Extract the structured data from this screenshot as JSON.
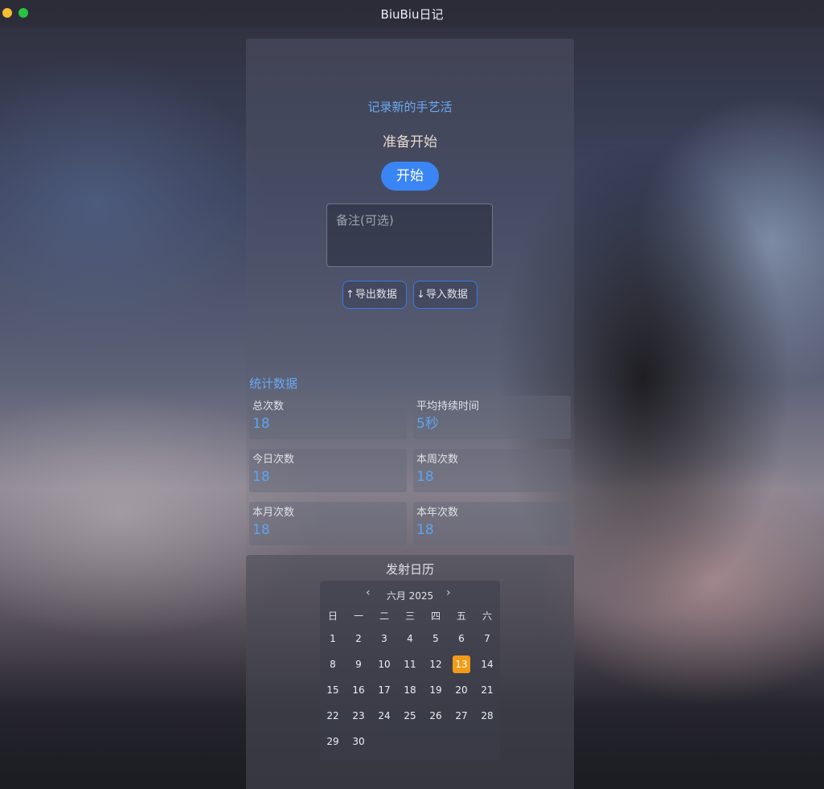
{
  "window": {
    "title": "BiuBiu日记"
  },
  "hero": {
    "heading": "记录新的手艺活",
    "status": "准备开始",
    "start_label": "开始",
    "note_placeholder": "备注(可选)",
    "export_label": "导出数据",
    "import_label": "导入数据"
  },
  "stats": {
    "title": "统计数据",
    "cards": [
      {
        "label": "总次数",
        "value": "18"
      },
      {
        "label": "平均持续时间",
        "value": "5秒"
      },
      {
        "label": "今日次数",
        "value": "18"
      },
      {
        "label": "本周次数",
        "value": "18"
      },
      {
        "label": "本月次数",
        "value": "18"
      },
      {
        "label": "本年次数",
        "value": "18"
      }
    ]
  },
  "calendar": {
    "title": "发射日历",
    "month_label": "六月 2025",
    "weekdays": [
      "日",
      "一",
      "二",
      "三",
      "四",
      "五",
      "六"
    ],
    "weeks": [
      [
        "1",
        "2",
        "3",
        "4",
        "5",
        "6",
        "7"
      ],
      [
        "8",
        "9",
        "10",
        "11",
        "12",
        "13",
        "14"
      ],
      [
        "15",
        "16",
        "17",
        "18",
        "19",
        "20",
        "21"
      ],
      [
        "22",
        "23",
        "24",
        "25",
        "26",
        "27",
        "28"
      ],
      [
        "29",
        "30",
        "",
        "",
        "",
        "",
        ""
      ]
    ],
    "selected_day": "13",
    "accent_color": "#f29b17"
  },
  "colors": {
    "primary": "#3a85f4",
    "heading": "#6aaaf2"
  }
}
